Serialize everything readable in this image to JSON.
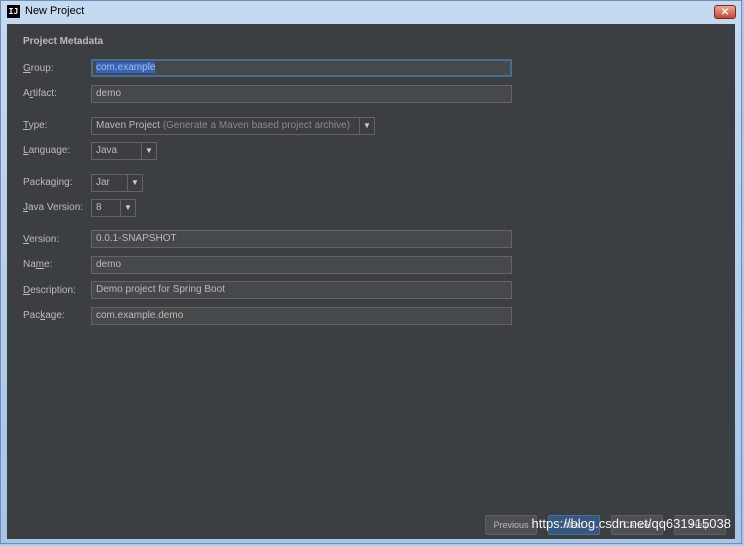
{
  "window": {
    "title": "New Project",
    "close": "✕",
    "app_icon": "IJ"
  },
  "section": {
    "title": "Project Metadata"
  },
  "fields": {
    "group": {
      "label_m": "G",
      "label_rest": "roup:",
      "value": "com.example"
    },
    "artifact": {
      "label_pre": "A",
      "label_m": "r",
      "label_rest": "tifact:",
      "value": "demo"
    },
    "type": {
      "label_m": "T",
      "label_rest": "ype:",
      "value": "Maven Project",
      "hint": "(Generate a Maven based project archive)"
    },
    "language": {
      "label_m": "L",
      "label_rest": "anguage:",
      "value": "Java"
    },
    "packaging": {
      "label_pre": "Packa",
      "label_m": "g",
      "label_rest": "ing:",
      "value": "Jar"
    },
    "java_version": {
      "label_m": "J",
      "label_rest": "ava Version:",
      "value": "8"
    },
    "version": {
      "label_m": "V",
      "label_rest": "ersion:",
      "value": "0.0.1-SNAPSHOT"
    },
    "name": {
      "label_pre": "Na",
      "label_m": "m",
      "label_rest": "e:",
      "value": "demo"
    },
    "description": {
      "label_m": "D",
      "label_rest": "escription:",
      "value": "Demo project for Spring Boot"
    },
    "package": {
      "label_pre": "Pac",
      "label_m": "k",
      "label_rest": "age:",
      "value": "com.example.demo"
    }
  },
  "buttons": {
    "previous": "Previous",
    "next": "Next",
    "cancel": "Cancel",
    "help": "Help"
  },
  "watermark": "https://blog.csdn.net/qq631915038",
  "colors": {
    "background": "#3c3f41",
    "selection": "#2f65ca",
    "focus": "#466d94",
    "text": "#bbbbbb"
  }
}
